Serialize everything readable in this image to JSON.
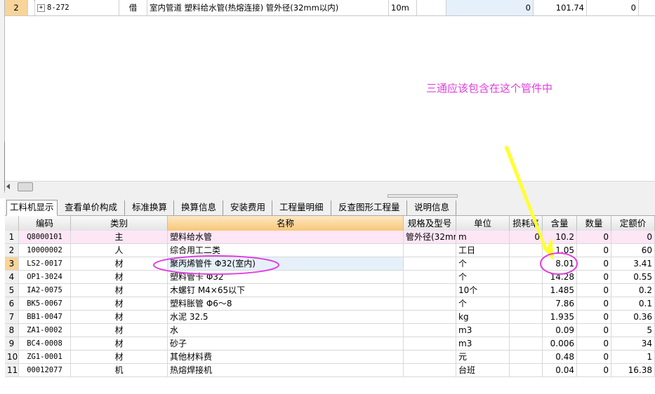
{
  "top_row": {
    "num": "2",
    "code": "8-272",
    "type": "借",
    "name": "室内管道 塑料给水管(热熔连接) 管外径(32mm以内)",
    "unit": "10m",
    "qty": "0",
    "price": "101.74",
    "total": "0"
  },
  "annotation": "三通应该包含在这个管件中",
  "tabs": [
    "工料机显示",
    "查看单价构成",
    "标准换算",
    "换算信息",
    "安装费用",
    "工程量明细",
    "反查图形工程量",
    "说明信息"
  ],
  "columns": [
    "编码",
    "类别",
    "名称",
    "规格及型号",
    "单位",
    "损耗率",
    "含量",
    "数量",
    "定额价"
  ],
  "rows": [
    {
      "num": "1",
      "code": "Q8000101",
      "type": "主",
      "name": "塑料给水管",
      "spec": "管外径(32mm",
      "unit": "m",
      "loss": "0",
      "content": "10.2",
      "qty": "0",
      "price": "0"
    },
    {
      "num": "2",
      "code": "10000002",
      "type": "人",
      "name": "综合用工二类",
      "spec": "",
      "unit": "工日",
      "loss": "",
      "content": "1.05",
      "qty": "0",
      "price": "60"
    },
    {
      "num": "3",
      "code": "LS2-0017",
      "type": "材",
      "name": "聚丙烯管件 Φ32(室内)",
      "spec": "",
      "unit": "个",
      "loss": "",
      "content": "8.01",
      "qty": "0",
      "price": "3.41"
    },
    {
      "num": "4",
      "code": "OP1-3024",
      "type": "材",
      "name": "塑料管卡 Φ32",
      "spec": "",
      "unit": "个",
      "loss": "",
      "content": "14.28",
      "qty": "0",
      "price": "0.55"
    },
    {
      "num": "5",
      "code": "IA2-0075",
      "type": "材",
      "name": "木螺钉 M4×65以下",
      "spec": "",
      "unit": "10个",
      "loss": "",
      "content": "1.485",
      "qty": "0",
      "price": "0.2"
    },
    {
      "num": "6",
      "code": "BK5-0067",
      "type": "材",
      "name": "塑料胀管 Φ6～8",
      "spec": "",
      "unit": "个",
      "loss": "",
      "content": "7.86",
      "qty": "0",
      "price": "0.1"
    },
    {
      "num": "7",
      "code": "BB1-0047",
      "type": "材",
      "name": "水泥 32.5",
      "spec": "",
      "unit": "kg",
      "loss": "",
      "content": "1.935",
      "qty": "0",
      "price": "0.36"
    },
    {
      "num": "8",
      "code": "ZA1-0002",
      "type": "材",
      "name": "水",
      "spec": "",
      "unit": "m3",
      "loss": "",
      "content": "0.09",
      "qty": "0",
      "price": "5"
    },
    {
      "num": "9",
      "code": "BC4-0008",
      "type": "材",
      "name": "砂子",
      "spec": "",
      "unit": "m3",
      "loss": "",
      "content": "0.006",
      "qty": "0",
      "price": "34"
    },
    {
      "num": "10",
      "code": "ZG1-0001",
      "type": "材",
      "name": "其他材料费",
      "spec": "",
      "unit": "元",
      "loss": "",
      "content": "0.48",
      "qty": "0",
      "price": "1"
    },
    {
      "num": "11",
      "code": "00012077",
      "type": "机",
      "name": "热熔焊接机",
      "spec": "",
      "unit": "台班",
      "loss": "",
      "content": "0.04",
      "qty": "0",
      "price": "16.38"
    }
  ],
  "colors": {
    "annotation": "#e040e0",
    "arrow": "#ffff33",
    "ellipse": "#e040e0",
    "main_row": "#fde6f6",
    "selected": "#f8d49a"
  }
}
